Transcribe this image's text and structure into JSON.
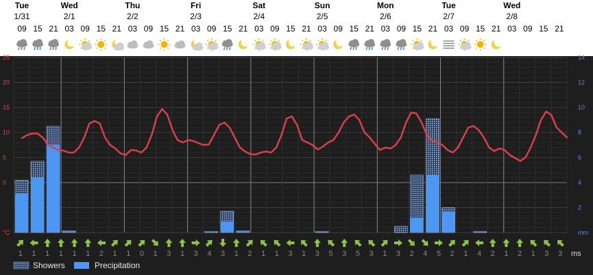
{
  "chart_data": {
    "type": "bar",
    "days": [
      {
        "name": "Tue",
        "date": "1/31",
        "slot": 0
      },
      {
        "name": "Wed",
        "date": "2/1",
        "slot": 3
      },
      {
        "name": "Thu",
        "date": "2/2",
        "slot": 7
      },
      {
        "name": "Fri",
        "date": "2/3",
        "slot": 11
      },
      {
        "name": "Sat",
        "date": "2/4",
        "slot": 15
      },
      {
        "name": "Sun",
        "date": "2/5",
        "slot": 19
      },
      {
        "name": "Mon",
        "date": "2/6",
        "slot": 23
      },
      {
        "name": "Tue",
        "date": "2/7",
        "slot": 27
      },
      {
        "name": "Wed",
        "date": "2/8",
        "slot": 31
      }
    ],
    "hours": [
      "09",
      "15",
      "21",
      "03",
      "09",
      "15",
      "21",
      "03",
      "09",
      "15",
      "21",
      "03",
      "09",
      "15",
      "21",
      "03",
      "09",
      "15",
      "21",
      "03",
      "09",
      "15",
      "21",
      "03",
      "09",
      "15",
      "21",
      "03",
      "09",
      "15",
      "21",
      "03",
      "09",
      "15",
      "21"
    ],
    "weather_icons": [
      "rain-cloud",
      "rain-cloud",
      "rain-cloud",
      "moon",
      "sun-cloud",
      "sun",
      "moon-cloud",
      "cloud",
      "cloud",
      "sun",
      "cloud",
      "moon-cloud",
      "sun-cloud",
      "rain-cloud",
      "moon",
      "sun-cloud",
      "sun-cloud",
      "moon",
      "sun-cloud",
      "sun-cloud",
      "moon",
      "rain-cloud",
      "rain-cloud",
      "rain-cloud",
      "rain-cloud",
      "sun-cloud",
      "moon",
      "fog",
      "sun-cloud",
      "sun",
      "moon"
    ],
    "temp_axis": {
      "unit": "°C",
      "ticks": [
        0,
        5,
        10,
        15,
        20,
        25
      ],
      "ylim": [
        -10,
        25
      ]
    },
    "precip_axis": {
      "unit": "mm",
      "ticks": [
        2,
        4,
        6,
        8,
        10,
        12,
        14
      ],
      "ylim": [
        0,
        14
      ]
    },
    "temperature": [
      8.9,
      9.5,
      9.8,
      9.8,
      9.0,
      7.6,
      7.0,
      6.5,
      6.4,
      6.0,
      6.0,
      7.0,
      9.0,
      11.8,
      12.3,
      11.8,
      9.0,
      7.5,
      6.8,
      5.8,
      5.5,
      6.5,
      6.4,
      6.0,
      7.0,
      9.5,
      13.2,
      14.7,
      13.6,
      10.5,
      8.5,
      8.0,
      8.5,
      8.3,
      7.9,
      7.5,
      7.6,
      9.5,
      11.5,
      12.0,
      11.0,
      9.0,
      7.0,
      6.2,
      5.7,
      5.6,
      6.0,
      6.2,
      6.0,
      7.0,
      9.5,
      12.8,
      13.2,
      11.5,
      8.5,
      8.0,
      7.5,
      6.6,
      7.2,
      8.0,
      8.5,
      10.0,
      12.0,
      13.2,
      13.6,
      12.5,
      10.0,
      9.0,
      7.7,
      6.5,
      7.0,
      6.8,
      7.5,
      9.0,
      12.0,
      14.0,
      13.8,
      12.0,
      9.5,
      8.5,
      8.0,
      7.5,
      6.5,
      6.0,
      7.0,
      9.0,
      11.0,
      11.3,
      10.5,
      9.0,
      7.0,
      6.3,
      6.8,
      6.5,
      5.5,
      4.9,
      4.3,
      5.0,
      7.0,
      9.5,
      12.5,
      14.2,
      13.5,
      11.0,
      10.0,
      9.0
    ],
    "precipitation": [
      1.7,
      2.4,
      3.6,
      0.05,
      0,
      0,
      0,
      0,
      0,
      0,
      0,
      0,
      0,
      0,
      0.05,
      0.6,
      0.05,
      0,
      0,
      0,
      0,
      0,
      0,
      0,
      0,
      0,
      0,
      0,
      0,
      0,
      0,
      0,
      0,
      0,
      0,
      0,
      0,
      0,
      0,
      0,
      0,
      0,
      0.05,
      0,
      0,
      0,
      0,
      0,
      0,
      0,
      0,
      0,
      0,
      0,
      0,
      0,
      0,
      0,
      0,
      0,
      0,
      0,
      0,
      0,
      0,
      0,
      0,
      0,
      0,
      0.05
    ],
    "bars": [
      {
        "slot": 0,
        "precipitation": 3.1,
        "showers": 4.2
      },
      {
        "slot": 1,
        "precipitation": 4.4,
        "showers": 5.7
      },
      {
        "slot": 2,
        "precipitation": 7.0,
        "showers": 8.5
      },
      {
        "slot": 3,
        "precipitation": 0.1,
        "showers": 0.15
      },
      {
        "slot": 12,
        "precipitation": 0,
        "showers": 0.1
      },
      {
        "slot": 13,
        "precipitation": 0.9,
        "showers": 1.7
      },
      {
        "slot": 14,
        "precipitation": 0.1,
        "showers": 0.15
      },
      {
        "slot": 19,
        "precipitation": 0,
        "showers": 0.1
      },
      {
        "slot": 24,
        "precipitation": 0,
        "showers": 0.5
      },
      {
        "slot": 25,
        "precipitation": 1.2,
        "showers": 4.6
      },
      {
        "slot": 26,
        "precipitation": 4.6,
        "showers": 9.1
      },
      {
        "slot": 27,
        "precipitation": 1.7,
        "showers": 2.0
      },
      {
        "slot": 29,
        "precipitation": 0,
        "showers": 0.1
      }
    ],
    "wind_speed": [
      1,
      1,
      1,
      1,
      1,
      1,
      2,
      1,
      1,
      0,
      1,
      3,
      1,
      3,
      4,
      3,
      1,
      2,
      1,
      1,
      3,
      1,
      3,
      5,
      3,
      5,
      3,
      1,
      3,
      2,
      4,
      5,
      2,
      1,
      4,
      2,
      1,
      2,
      1,
      3,
      3
    ],
    "wind_dir_deg": [
      45,
      270,
      0,
      0,
      0,
      0,
      270,
      45,
      45,
      45,
      135,
      0,
      0,
      90,
      45,
      180,
      0,
      45,
      315,
      315,
      270,
      315,
      0,
      315,
      0,
      315,
      315,
      45,
      90,
      135,
      135,
      90,
      45,
      45,
      270,
      0,
      0,
      0,
      315,
      315,
      315
    ],
    "wind_unit": "ms",
    "legend": [
      {
        "label": "Showers",
        "color": "#8fb8f0"
      },
      {
        "label": "Precipitation",
        "color": "#4d96f2"
      }
    ],
    "colors": {
      "temperature": "#d9404a",
      "precipitation": "#4d96f2",
      "wind": "#8cc63f",
      "grid": "#555555"
    }
  }
}
